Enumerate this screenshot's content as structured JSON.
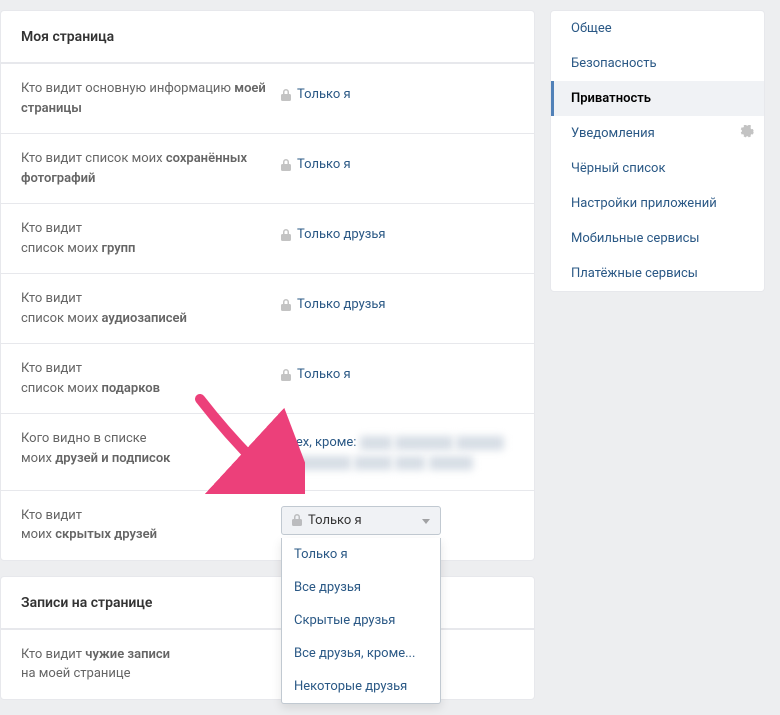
{
  "section1_title": "Моя страница",
  "section2_title": "Записи на странице",
  "rows": [
    {
      "label_pre": "Кто видит основную информацию ",
      "label_bold": "моей страницы",
      "value": "Только я",
      "locked": true
    },
    {
      "label_pre": "Кто видит список моих ",
      "label_bold": "сохранённых фотографий",
      "value": "Только я",
      "locked": true
    },
    {
      "label_pre": "Кто видит\nсписок моих ",
      "label_bold": "групп",
      "value": "Только друзья",
      "locked": true
    },
    {
      "label_pre": "Кто видит\nсписок моих ",
      "label_bold": "аудиозаписей",
      "value": "Только друзья",
      "locked": true
    },
    {
      "label_pre": "Кто видит\nсписок моих ",
      "label_bold": "подарков",
      "value": "Только я",
      "locked": true
    },
    {
      "label_pre": "Кого видно в списке\nмоих ",
      "label_bold": "друзей и подписок",
      "value_prefix": "Всех, кроме: ",
      "redacted": true
    },
    {
      "label_pre": "Кто видит\nмоих ",
      "label_bold": "скрытых друзей",
      "dropdown": true
    }
  ],
  "row_posts": {
    "label_pre": "Кто видит ",
    "label_bold": "чужие записи",
    "label_post": "\nна моей странице"
  },
  "dropdown": {
    "selected": "Только я",
    "options": [
      "Только я",
      "Все друзья",
      "Скрытые друзья",
      "Все друзья, кроме...",
      "Некоторые друзья"
    ]
  },
  "sidebar_items": [
    {
      "label": "Общее",
      "active": false
    },
    {
      "label": "Безопасность",
      "active": false
    },
    {
      "label": "Приватность",
      "active": true
    },
    {
      "label": "Уведомления",
      "active": false,
      "gear": true
    },
    {
      "label": "Чёрный список",
      "active": false
    },
    {
      "label": "Настройки приложений",
      "active": false
    },
    {
      "label": "Мобильные сервисы",
      "active": false
    },
    {
      "label": "Платёжные сервисы",
      "active": false
    }
  ]
}
